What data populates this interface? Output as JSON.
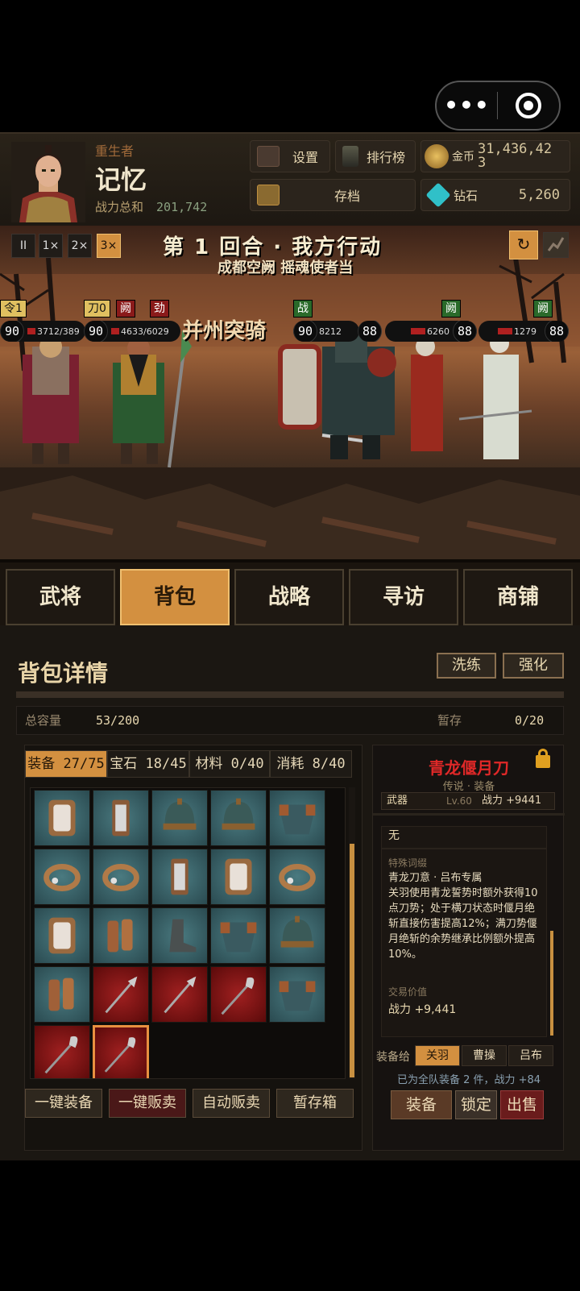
{
  "capsule": {
    "menu_icon": "more-dots-icon",
    "close_icon": "target-icon"
  },
  "player": {
    "title": "重生者",
    "name": "记忆",
    "power_label": "战力总和",
    "power_value": "201,742"
  },
  "header_buttons": {
    "settings": "设置",
    "ranking": "排行榜",
    "save": "存档"
  },
  "currency": {
    "gold_label": "金币",
    "gold_value": "31,436,42",
    "gold_value_line2": "3",
    "diamond_label": "钻石",
    "diamond_value": "5,260"
  },
  "battle": {
    "controls": {
      "pause": "II",
      "speed1": "1×",
      "speed2": "2×",
      "speed3": "3×",
      "active_speed": "3×"
    },
    "turn_text": "第 1 回合 · 我方行动",
    "subtitle": "成都空阙 摇魂使者当",
    "unit_name": "并州突骑",
    "allies": [
      {
        "tags": [
          "令1"
        ],
        "level": "90",
        "hp": "3712/389"
      },
      {
        "tags": [
          "刀0",
          "阙",
          "劲"
        ],
        "level": "90",
        "hp": "4633/6029"
      }
    ],
    "enemies": [
      {
        "tags": [
          "战"
        ],
        "level": "90",
        "hp": "8212"
      },
      {
        "tags": [],
        "level": "88",
        "hp": ""
      },
      {
        "tags": [
          "阙"
        ],
        "level": "88",
        "hp": "6260"
      },
      {
        "tags": [
          "阙"
        ],
        "level": "88",
        "hp": "1279"
      }
    ]
  },
  "tabs": [
    "武将",
    "背包",
    "战略",
    "寻访",
    "商铺"
  ],
  "active_tab": "背包",
  "backpack": {
    "title": "背包详情",
    "wash_button": "洗练",
    "enhance_button": "强化",
    "capacity_label": "总容量",
    "capacity_value": "53/200",
    "temp_label": "暂存",
    "temp_value": "0/20",
    "categories": [
      {
        "label": "装备 27/75",
        "active": true
      },
      {
        "label": "宝石 18/45",
        "active": false
      },
      {
        "label": "材料 0/40",
        "active": false
      },
      {
        "label": "消耗 8/40",
        "active": false
      }
    ],
    "items": [
      {
        "icon": "mirror-armor-icon",
        "red": false
      },
      {
        "icon": "pendant-icon",
        "red": false
      },
      {
        "icon": "helmet-icon",
        "red": false
      },
      {
        "icon": "helmet-icon",
        "red": false
      },
      {
        "icon": "body-armor-icon",
        "red": false
      },
      {
        "icon": "ring-icon",
        "red": false
      },
      {
        "icon": "ring-icon",
        "red": false
      },
      {
        "icon": "pendant-icon",
        "red": false
      },
      {
        "icon": "mirror-armor-icon",
        "red": false
      },
      {
        "icon": "ring-icon",
        "red": false
      },
      {
        "icon": "mirror-armor-icon",
        "red": false
      },
      {
        "icon": "bracer-icon",
        "red": false
      },
      {
        "icon": "boots-icon",
        "red": false
      },
      {
        "icon": "body-armor-icon",
        "red": false
      },
      {
        "icon": "helmet-icon",
        "red": false
      },
      {
        "icon": "bracer-icon",
        "red": false
      },
      {
        "icon": "halberd-icon",
        "red": true
      },
      {
        "icon": "halberd-icon",
        "red": true
      },
      {
        "icon": "glaive-icon",
        "red": true
      },
      {
        "icon": "body-armor-icon",
        "red": false
      },
      {
        "icon": "glaive-icon",
        "red": true
      },
      {
        "icon": "glaive-icon",
        "red": true,
        "selected": true
      }
    ],
    "actions": [
      "一键装备",
      "一键贩卖",
      "自动贩卖",
      "暂存箱"
    ]
  },
  "detail": {
    "name": "青龙偃月刀",
    "lock_icon": "lock-icon",
    "subline": "传说 · 装备",
    "type": "武器",
    "level": "Lv.60",
    "power": "战力 +9441",
    "none_text": "无",
    "special_label": "特殊词缀",
    "special_title": "青龙刀意 · 吕布专属",
    "special_text": "关羽使用青龙誓势时额外获得10点刀势；处于横刀状态时偃月绝斩直接伤害提高12%；满刀势偃月绝斩的余势继承比例额外提高10%。",
    "trade_label": "交易价值",
    "trade_value": "战力 +9,441",
    "equip_for_label": "装备给",
    "heroes": [
      "关羽",
      "曹操",
      "吕布"
    ],
    "active_hero": "关羽",
    "note": "已为全队装备 2 件，战力 +84",
    "buttons": [
      "装备",
      "锁定",
      "出售"
    ]
  },
  "colors": {
    "accent": "#d39040",
    "legend_red": "#e02828",
    "panel_bg": "#1b1712"
  }
}
